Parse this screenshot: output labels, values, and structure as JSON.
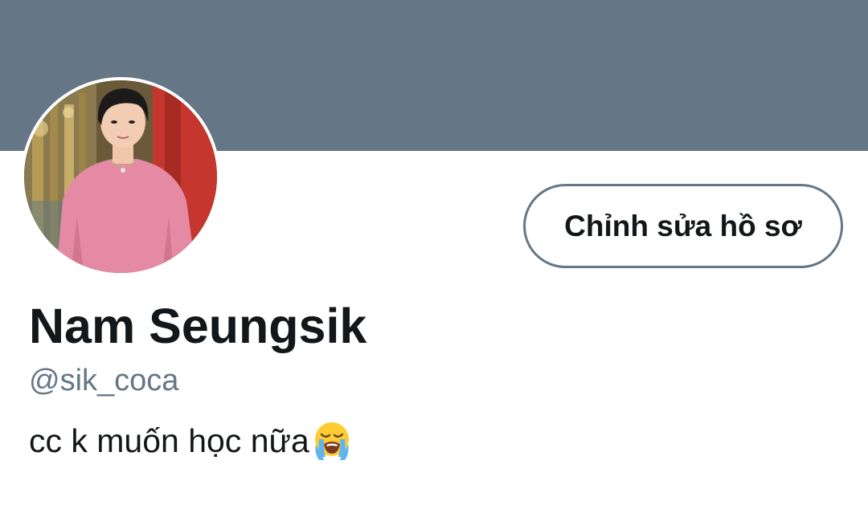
{
  "profile": {
    "display_name": "Nam Seungsik",
    "handle": "@sik_coca",
    "bio_text": "cc k muốn học nữa",
    "bio_emoji": "loudly-crying-face-emoji",
    "edit_button_label": "Chỉnh sửa hồ sơ"
  },
  "colors": {
    "banner": "#657786",
    "name": "#14171a",
    "handle": "#657786",
    "button_border": "#657786"
  }
}
